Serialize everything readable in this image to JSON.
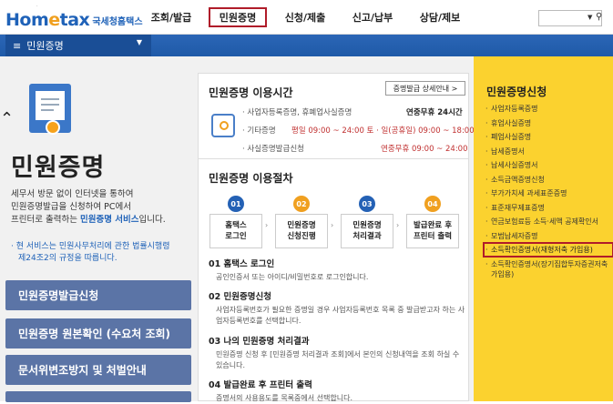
{
  "header": {
    "logo_brand_a": "Hom",
    "logo_brand_e": "e",
    "logo_brand_b": "tax",
    "logo_kr": "국세청홈택스",
    "menu": [
      "조회/발급",
      "민원증명",
      "신청/제출",
      "신고/납부",
      "상담/제보"
    ],
    "selected_menu": "민원증명"
  },
  "breadcrumb": {
    "label": "민원증명"
  },
  "left": {
    "title": "민원증명",
    "desc_1": "세무서 방문 없이 인터넷을 통하여",
    "desc_2": "민원증명발급을 신청하여 PC에서",
    "desc_3a": "프린터로 출력하는 ",
    "desc_3b": "민원증명 서비스",
    "desc_3c": "입니다.",
    "note_1": "· 현 서비스는 민원사무처리에 관한 법률시행령",
    "note_2": "제24조2의 규정을 따릅니다.",
    "buttons": [
      "민원증명발급신청",
      "민원증명 원본확인 (수요처 조회)",
      "문서위변조방지 및 처벌안내"
    ]
  },
  "hours": {
    "title": "민원증명 이용시간",
    "detail_button": "증명발급 상세안내 >",
    "row1_label": "· 사업자등록증명, 휴폐업사실증명",
    "row1_right": "연중무휴 24시간",
    "row2_label": "· 기타증명",
    "row2_right": "평일 09:00 ~ 24:00  토 · 일(공휴일) 09:00 ~ 18:00",
    "row3_label": "· 사실증명발급신청",
    "row3_right": "연중무휴 09:00 ~ 24:00"
  },
  "procedure": {
    "title": "민원증명 이용절차",
    "steps": [
      {
        "num": "01",
        "label": "홈택스\n로그인"
      },
      {
        "num": "02",
        "label": "민원증명\n신청진행"
      },
      {
        "num": "03",
        "label": "민원증명\n처리결과"
      },
      {
        "num": "04",
        "label": "발급완료 후\n프린터 출력"
      }
    ],
    "sections": [
      {
        "title": "01 홈택스 로그인",
        "desc": "공인인증서 또는 아이디/비밀번호로 로그인합니다."
      },
      {
        "title": "02 민원증명신청",
        "desc": "사업자등록번호가 필요한 증명일 경우 사업자등록번호 목록 중 발급받고자 하는 사업자등록번호를 선택합니다."
      },
      {
        "title": "03 나의 민원증명 처리결과",
        "desc": "민원증명 신청 후 [민원증명 처리결과 조회]에서 본인의 신청내역을 조회 하실 수 있습니다."
      },
      {
        "title": "04 발급완료 후 프린터 출력",
        "desc": "증명서의 사용용도를 목록중에서 선택합니다."
      }
    ]
  },
  "right": {
    "title": "민원증명신청",
    "items": [
      "사업자등록증명",
      "휴업사실증명",
      "폐업사실증명",
      "납세증명서",
      "납세사실증명서",
      "소득금액증명신청",
      "부가가치세 과세표준증명",
      "표준재무제표증명",
      "연금보험료등 소득·세액 공제확인서",
      "모범납세자증명",
      "소득확인증명서(재형저축 가입용)",
      "소득확인증명서(장기집합투자증권저축가입용)"
    ],
    "highlighted_index": 10
  },
  "colors": {
    "brand": "#1f62b8",
    "selected_outline": "#b01c2a",
    "side_panel": "#fbd22f",
    "nav_bar": "#2b66b6"
  }
}
